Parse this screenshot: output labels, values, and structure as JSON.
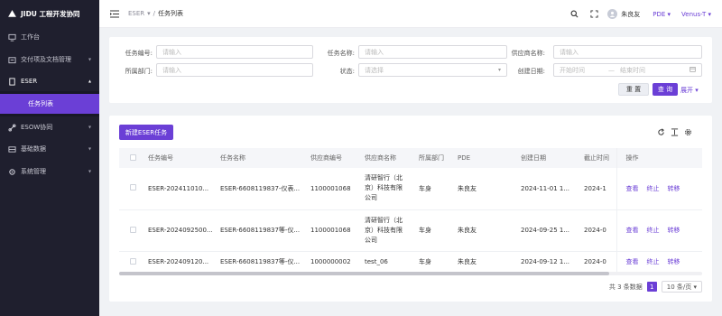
{
  "app": {
    "title": "JIDU 工程开发协同"
  },
  "sidebar": {
    "items": [
      {
        "label": "工作台",
        "icon": "monitor-icon"
      },
      {
        "label": "交付项及文档管理",
        "icon": "folder-icon"
      },
      {
        "label": "ESER",
        "icon": "doc-icon"
      },
      {
        "label": "ESOW协同",
        "icon": "link-icon"
      },
      {
        "label": "基础数据",
        "icon": "database-icon"
      },
      {
        "label": "系统管理",
        "icon": "gear-icon"
      }
    ],
    "sub_active": "任务列表"
  },
  "topbar": {
    "breadcrumb_parent": "ESER",
    "breadcrumb_sep": "/",
    "breadcrumb_current": "任务列表",
    "user_name": "朱良友",
    "role": "PDE",
    "project": "Venus-T"
  },
  "search": {
    "fields": [
      {
        "label": "任务编号:",
        "placeholder": "请输入"
      },
      {
        "label": "任务名称:",
        "placeholder": "请输入"
      },
      {
        "label": "供应商名称:",
        "placeholder": "请输入"
      },
      {
        "label": "所属部门:",
        "placeholder": "请输入"
      },
      {
        "label": "状态:",
        "placeholder": "请选择"
      },
      {
        "label": "创建日期:",
        "start_placeholder": "开始时间",
        "range_sep": "—",
        "end_placeholder": "结束时间"
      }
    ],
    "reset_label": "重 置",
    "query_label": "查 询",
    "expand_label": "展开"
  },
  "table": {
    "new_button": "新建ESER任务",
    "columns": [
      "任务编号",
      "任务名称",
      "供应商编号",
      "供应商名称",
      "所属部门",
      "PDE",
      "创建日期",
      "截止时间",
      "操作"
    ],
    "rows": [
      {
        "task_no": "ESER-202411010...",
        "task_name": "ESER-6608119837-仪表...",
        "supplier_no": "1100001068",
        "supplier_name_l1": "清研智行（北",
        "supplier_name_l2": "京）科技有限",
        "supplier_name_l3": "公司",
        "dept": "车身",
        "pde": "朱良友",
        "created": "2024-11-01 1...",
        "deadline": "2024-1"
      },
      {
        "task_no": "ESER-2024092500...",
        "task_name": "ESER-6608119837等-仪...",
        "supplier_no": "1100001068",
        "supplier_name_l1": "清研智行（北",
        "supplier_name_l2": "京）科技有限",
        "supplier_name_l3": "公司",
        "dept": "车身",
        "pde": "朱良友",
        "created": "2024-09-25 1...",
        "deadline": "2024-0"
      },
      {
        "task_no": "ESER-202409120...",
        "task_name": "ESER-6608119837等-仪...",
        "supplier_no": "1000000002",
        "supplier_name_l1": "test_06",
        "supplier_name_l2": "",
        "supplier_name_l3": "",
        "dept": "车身",
        "pde": "朱良友",
        "created": "2024-09-12 1...",
        "deadline": "2024-0"
      }
    ],
    "actions": [
      "查看",
      "终止",
      "转移"
    ]
  },
  "pager": {
    "total_text": "共 3 条数据",
    "current_page": "1",
    "page_size": "10 条/页"
  },
  "colors": {
    "accent": "#6b3fd6",
    "sidebar_bg": "#1f1f2e"
  }
}
